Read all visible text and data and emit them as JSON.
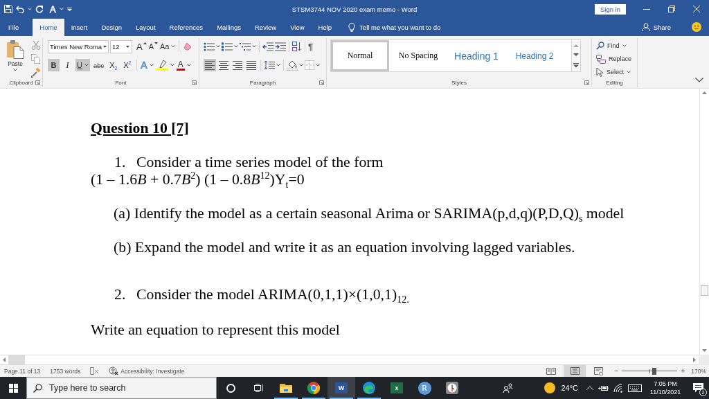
{
  "window": {
    "title": "STSM3744 NOV 2020 exam memo - Word",
    "quick_access_label": "A",
    "sign_in": "Sign in"
  },
  "tabs": [
    {
      "label": "File",
      "selected": false
    },
    {
      "label": "Home",
      "selected": true
    },
    {
      "label": "Insert",
      "selected": false
    },
    {
      "label": "Design",
      "selected": false
    },
    {
      "label": "Layout",
      "selected": false
    },
    {
      "label": "References",
      "selected": false
    },
    {
      "label": "Mailings",
      "selected": false
    },
    {
      "label": "Review",
      "selected": false
    },
    {
      "label": "View",
      "selected": false
    },
    {
      "label": "Help",
      "selected": false
    }
  ],
  "tell_me": {
    "placeholder": "Tell me what you want to do"
  },
  "share": "Share",
  "ribbon": {
    "clipboard": {
      "paste": "Paste",
      "label": "Clipboard"
    },
    "font": {
      "font_name": "Times New Roma",
      "font_size": "12",
      "grow": "A",
      "shrink": "A",
      "change_case": "Aa",
      "formats": [
        {
          "kind": "bold",
          "label": "B",
          "on": true
        },
        {
          "kind": "italic",
          "label": "I",
          "on": false
        },
        {
          "kind": "underline",
          "label": "U",
          "on": true
        },
        {
          "kind": "strikethrough",
          "label": "abc",
          "on": false
        },
        {
          "kind": "subscript",
          "label": "X$_{2}$",
          "on": false
        },
        {
          "kind": "superscript",
          "label": "X$^{2}$",
          "on": false
        }
      ],
      "text_effects": "A",
      "font_color": "A",
      "label": "Font"
    },
    "paragraph": {
      "pilcrow": "¶",
      "alignments": [
        {
          "kind": "left",
          "selected": true
        },
        {
          "kind": "center",
          "selected": false
        },
        {
          "kind": "right",
          "selected": false
        },
        {
          "kind": "justify",
          "selected": false
        }
      ],
      "label": "Paragraph"
    },
    "styles": {
      "items": [
        {
          "kind": "normal",
          "label": "Normal",
          "selected": true
        },
        {
          "kind": "no_spacing",
          "label": "No Spacing",
          "selected": false
        },
        {
          "kind": "heading1",
          "label": "Heading 1",
          "selected": false
        },
        {
          "kind": "heading2",
          "label": "Heading 2",
          "selected": false
        }
      ],
      "label": "Styles"
    },
    "editing": {
      "items": [
        {
          "kind": "find",
          "label": "Find"
        },
        {
          "kind": "replace",
          "label": "Replace"
        },
        {
          "kind": "select",
          "label": "Select"
        }
      ],
      "label": "Editing"
    }
  },
  "document": {
    "heading": "Question 10 [7]",
    "items": [
      {
        "kind": "numbered",
        "number": "1.",
        "text": "Consider a time series model of the form"
      },
      {
        "kind": "equation",
        "parts": [
          {
            "kind": "plain",
            "text": "(1 – 1.6"
          },
          {
            "kind": "variable",
            "text": "B"
          },
          {
            "kind": "plain",
            "text": " + 0.7"
          },
          {
            "kind": "variable",
            "text": "B"
          },
          {
            "kind": "power",
            "text": "2"
          },
          {
            "kind": "plain",
            "text": ") (1 – 0.8"
          },
          {
            "kind": "variable",
            "text": "B"
          },
          {
            "kind": "power",
            "text": "12"
          },
          {
            "kind": "plain",
            "text": ")Y"
          },
          {
            "kind": "index",
            "text": "t"
          },
          {
            "kind": "plain",
            "text": "=0"
          }
        ]
      },
      {
        "kind": "sub",
        "text": "(a) Identify the model as a certain seasonal Arima or SARIMA(p,d,q)(P,D,Q)$_{s}$ model"
      },
      {
        "kind": "sub",
        "text": "(b) Expand the model and write it as an equation involving lagged variables."
      },
      {
        "kind": "numbered",
        "number": "2.",
        "text": "Consider the model ARIMA(0,1,1)×(1,0,1)$_{12.}$"
      },
      {
        "kind": "plain",
        "text": "Write an equation to represent this model"
      }
    ]
  },
  "status_bar": {
    "page": "Page 11 of 13",
    "words": "1753 words",
    "accessibility": "Accessibility: Investigate",
    "views": [
      {
        "kind": "read",
        "selected": false
      },
      {
        "kind": "print",
        "selected": true
      },
      {
        "kind": "web",
        "selected": false
      }
    ],
    "zoom": {
      "minus": "−",
      "plus": "+",
      "level": 0.59,
      "reading": "170%"
    }
  },
  "taskbar": {
    "search": {
      "placeholder": "Type here to search"
    },
    "apps": [
      {
        "kind": "explorer",
        "running": true,
        "active": false
      },
      {
        "kind": "browser",
        "running": true,
        "active": false
      },
      {
        "kind": "word",
        "label": "W",
        "running": true,
        "active": true
      },
      {
        "kind": "edge",
        "running": true,
        "active": false
      },
      {
        "kind": "excel",
        "label": "x",
        "running": false,
        "active": false
      },
      {
        "kind": "r",
        "label": "R",
        "running": false,
        "active": false
      },
      {
        "kind": "clock",
        "running": false,
        "active": false
      }
    ],
    "weather": "24°C",
    "time": "7:05 PM",
    "date": "11/10/2021",
    "notifications": "2"
  }
}
